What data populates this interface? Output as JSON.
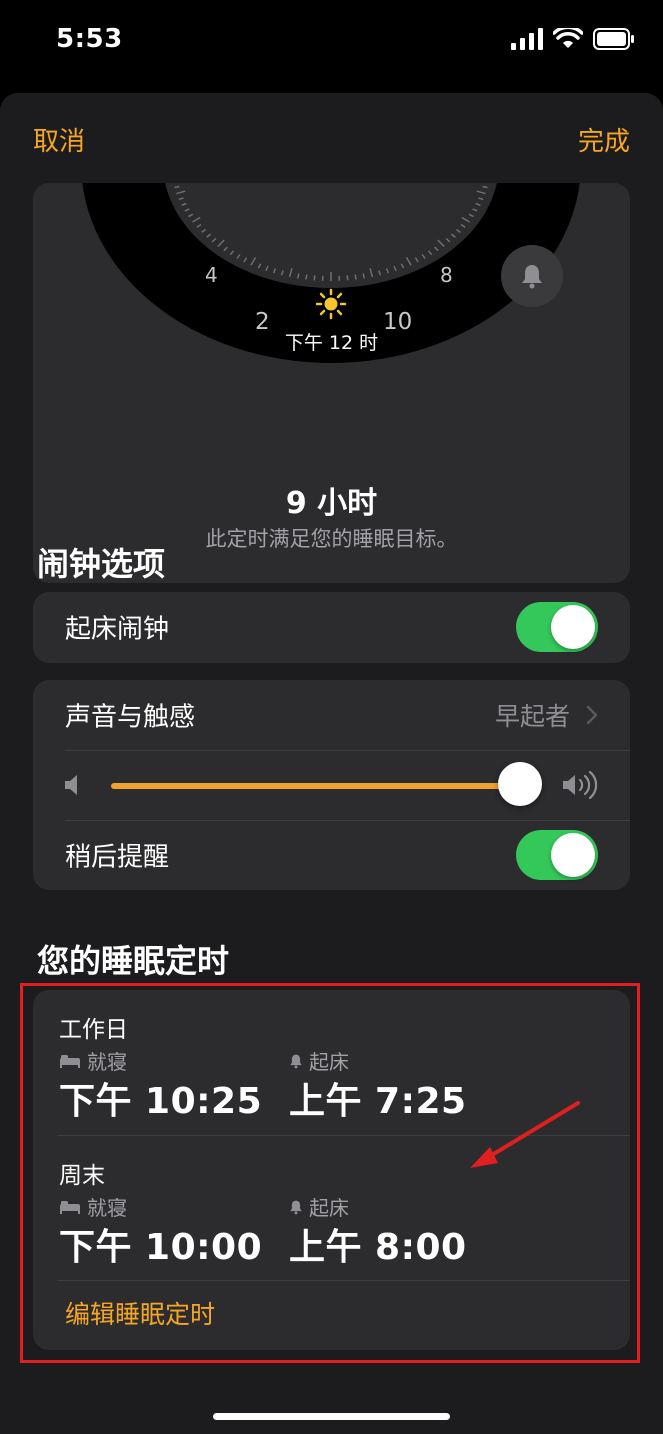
{
  "status_bar": {
    "time": "5:53"
  },
  "nav": {
    "cancel": "取消",
    "done": "完成"
  },
  "clock": {
    "hour_labels": [
      "4",
      "8",
      "2",
      "10"
    ],
    "noon_label": "下午 12 时",
    "duration": "9 小时",
    "goal_text": "此定时满足您的睡眠目标。"
  },
  "alarm_options": {
    "title": "闹钟选项",
    "wake_alarm": {
      "label": "起床闹钟",
      "on": true
    },
    "sound": {
      "label": "声音与触感",
      "value": "早起者"
    },
    "volume_level": 0.93,
    "snooze": {
      "label": "稍后提醒",
      "on": true
    }
  },
  "schedule": {
    "title": "您的睡眠定时",
    "weekday": {
      "label": "工作日",
      "bedtime_label": "就寝",
      "bedtime": "下午 10:25",
      "wake_label": "起床",
      "wake": "上午 7:25"
    },
    "weekend": {
      "label": "周末",
      "bedtime_label": "就寝",
      "bedtime": "下午 10:00",
      "wake_label": "起床",
      "wake": "上午 8:00"
    },
    "edit": "编辑睡眠定时"
  },
  "colors": {
    "accent": "#F5A623",
    "toggle_on": "#34C759",
    "annotation": "#E02020"
  }
}
